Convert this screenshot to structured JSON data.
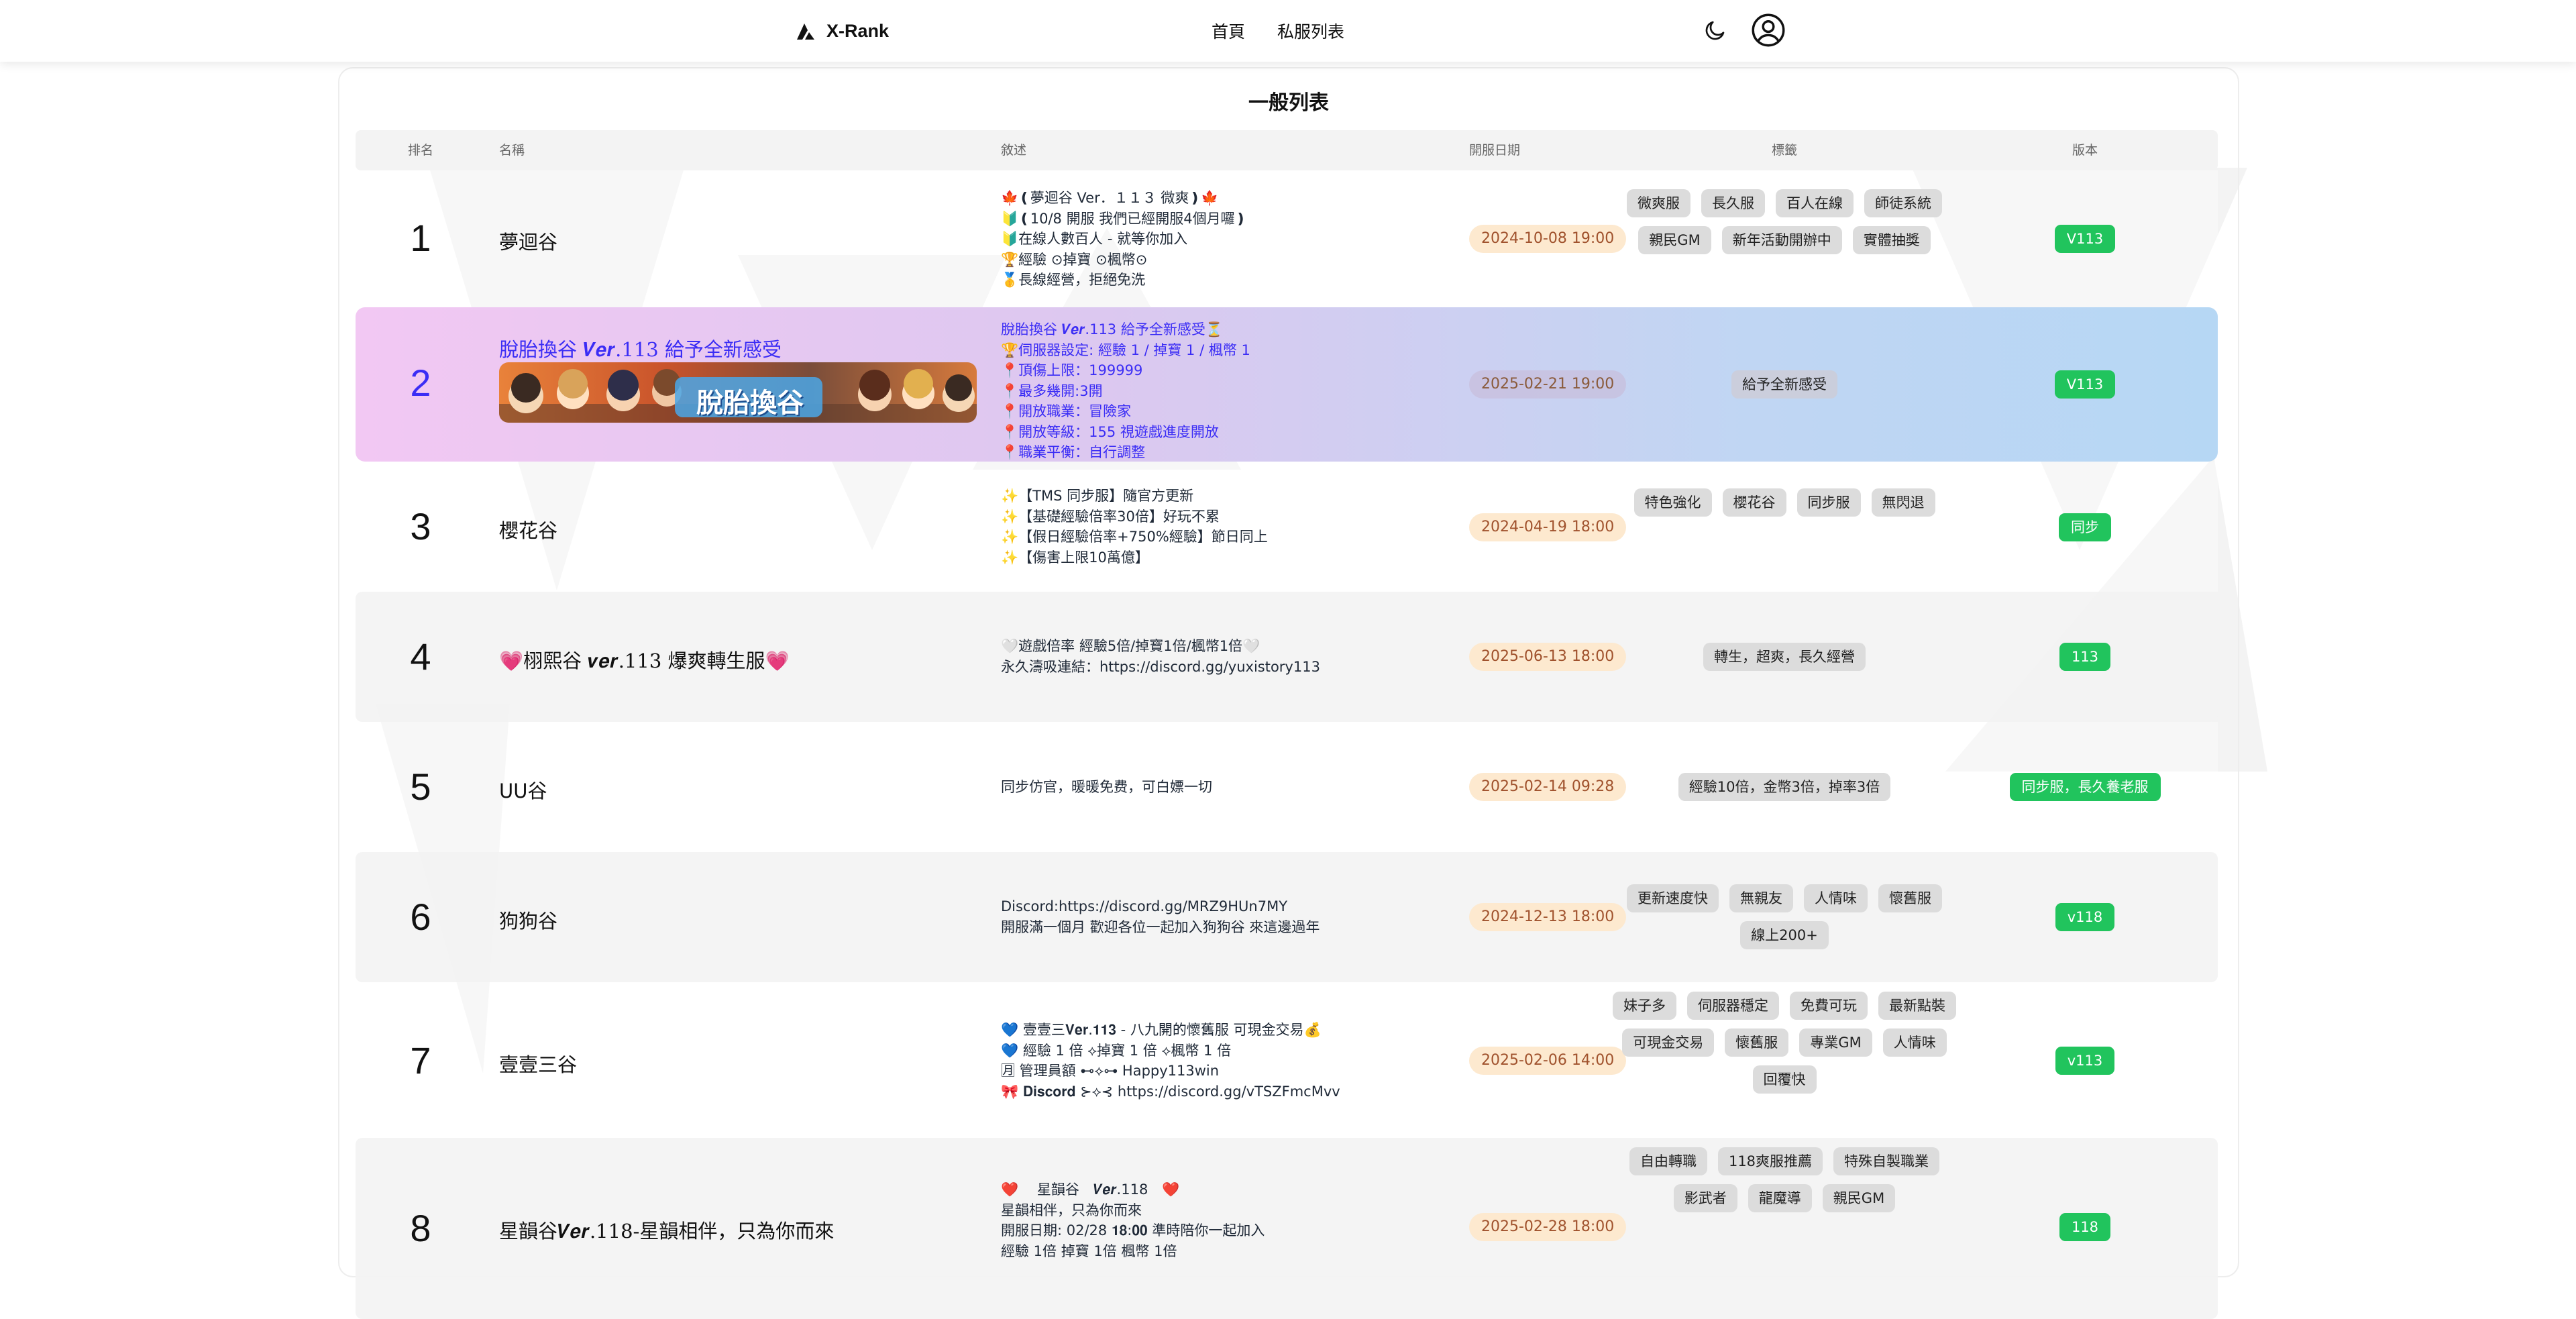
{
  "header": {
    "brand": "X-Rank",
    "nav": [
      "首頁",
      "私服列表"
    ],
    "icons": {
      "logo": "x-rank-logo",
      "theme": "moon-icon",
      "user": "user-circle-icon"
    }
  },
  "list": {
    "title": "一般列表",
    "columns": [
      "排名",
      "名稱",
      "敘述",
      "開服日期",
      "標籤",
      "版本"
    ],
    "rows": [
      {
        "rank": "1",
        "name": "夢迴谷",
        "desc": [
          "🍁❪夢迴谷 Ver．１１３ 微爽❫🍁",
          "🔰❪10/8 開服 我們已經開服4個月囉❫",
          "🔰在線人數百人 - 就等你加入",
          "🏆經驗 ⊙掉寶 ⊙楓幣⊙",
          "🥇長線經營，拒絕免洗"
        ],
        "date": "2024-10-08 19:00",
        "tags": [
          "微爽服",
          "長久服",
          "百人在線",
          "師徒系統",
          "親民GM",
          "新年活動開辦中",
          "實體抽獎"
        ],
        "version": "V113"
      },
      {
        "rank": "2",
        "name": "脫胎換谷 𝑽𝒆𝒓.113 給予全新感受",
        "banner": "脫胎換谷",
        "desc": [
          "脫胎換谷 𝑽𝒆𝒓.113 給予全新感受⏳",
          "🏆伺服器設定: 經驗 1 / 掉寶 1 / 楓幣 1",
          "📍頂傷上限：199999",
          "📍最多幾開:3開",
          "📍開放職業：冒險家",
          "📍開放等級：155 視遊戲進度開放",
          "📍職業平衡：自行調整"
        ],
        "date": "2025-02-21 19:00",
        "tags": [
          "給予全新感受"
        ],
        "version": "V113"
      },
      {
        "rank": "3",
        "name": "櫻花谷",
        "desc": [
          "✨【TMS 同步服】隨官方更新",
          "✨【基礎經驗倍率30倍】好玩不累",
          "✨【假日經驗倍率+750%經驗】節日同上",
          "✨【傷害上限10萬億】"
        ],
        "date": "2024-04-19 18:00",
        "tags": [
          "特色強化",
          "櫻花谷",
          "同步服",
          "無閃退"
        ],
        "version": "同步"
      },
      {
        "rank": "4",
        "name": "💗栩熙谷 𝒗𝒆𝒓.113 爆爽轉生服💗",
        "desc": [
          "🤍遊戲倍率 經驗5倍/掉寶1倍/楓幣1倍🤍",
          "永久濤吸連結：https://discord.gg/yuxistory113"
        ],
        "date": "2025-06-13 18:00",
        "tags": [
          "轉生，超爽，長久經營"
        ],
        "version": "113"
      },
      {
        "rank": "5",
        "name": "UU谷",
        "desc": [
          "同步仿官，暖暖免费，可白嫖一切"
        ],
        "date": "2025-02-14 09:28",
        "tags": [
          "經驗10倍，金幣3倍，掉率3倍"
        ],
        "version": "同步服，長久養老服"
      },
      {
        "rank": "6",
        "name": "狗狗谷",
        "desc": [
          "Discord:https://discord.gg/MRZ9HUn7MY",
          "開服滿一個月 歡迎各位一起加入狗狗谷 來這邊過年"
        ],
        "date": "2024-12-13 18:00",
        "tags": [
          "更新速度快",
          "無親友",
          "人情味",
          "懷舊服",
          "線上200+"
        ],
        "version": "v118"
      },
      {
        "rank": "7",
        "name": "壹壹三谷",
        "desc": [
          "💙 壹壹三𝐕𝐞𝐫.𝟏𝟏𝟑 - 八九開的懷舊服 可現金交易💰",
          "💙 經驗 1 倍 ⟡掉寶 1 倍 ⟡楓幣 1 倍",
          "🈷 管理員額 ⊷⟡⊶ Happy113win",
          "🎀 𝐃𝐢𝐬𝐜𝐨𝐫𝐝 ⊱⟡⊰ https://discord.gg/vTSZFmcMvv"
        ],
        "date": "2025-02-06 14:00",
        "tags": [
          "妹子多",
          "伺服器穩定",
          "免費可玩",
          "最新點裝",
          "可現金交易",
          "懷舊服",
          "專業GM",
          "人情味",
          "回覆快"
        ],
        "version": "v113"
      },
      {
        "rank": "8",
        "name": "星韻谷𝑽𝒆𝒓.118-星韻相伴，只為你而來",
        "desc": [
          "❤️ 　星韻谷　𝑽𝒆𝒓.118　❤️",
          "星韻相伴，只為你而來",
          "開服日期: 02/28 𝟏𝟖:𝟎𝟎 準時陪你一起加入",
          "經驗 1倍 掉寶 1倍 楓幣 1倍"
        ],
        "date": "2025-02-28 18:00",
        "tags": [
          "自由轉職",
          "118爽服推薦",
          "特殊自製職業",
          "影武者",
          "龍魔導",
          "親民GM"
        ],
        "version": "118"
      }
    ]
  }
}
